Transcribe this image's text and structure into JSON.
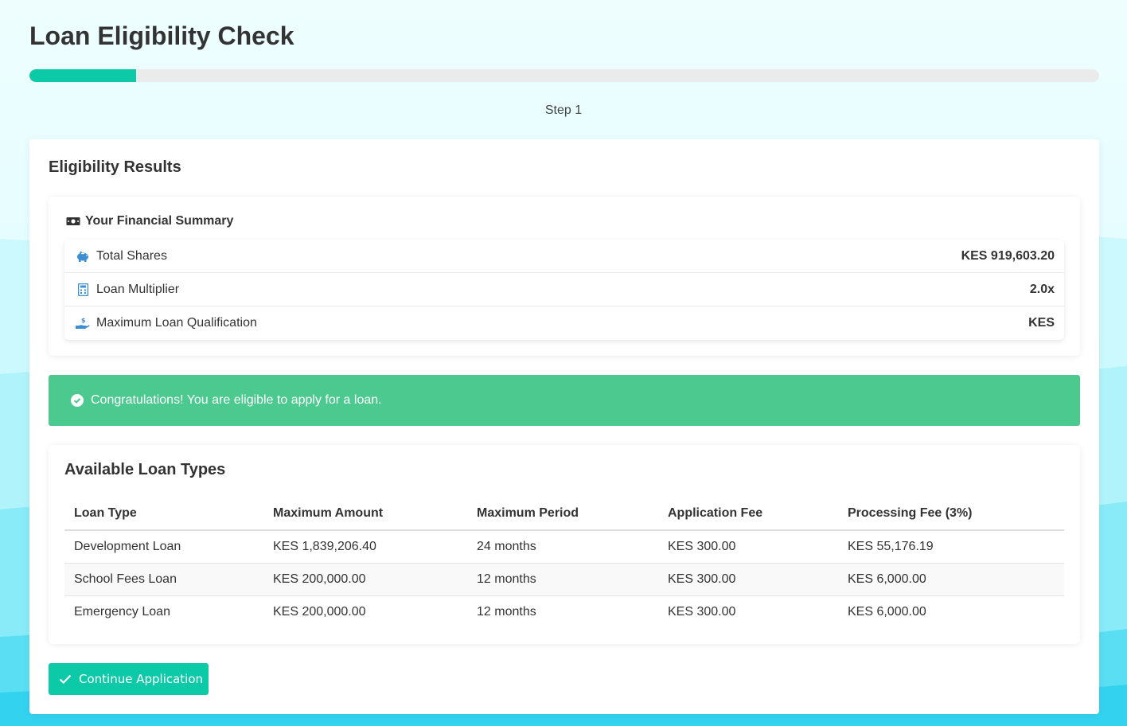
{
  "header": {
    "title": "Loan Eligibility Check",
    "step_label": "Step 1",
    "progress_percent": 10
  },
  "results": {
    "title": "Eligibility Results",
    "summary": {
      "title": "Your Financial Summary",
      "icon": "money-bill-icon",
      "rows": [
        {
          "icon": "piggy-bank-icon",
          "label": "Total Shares",
          "value": "KES 919,603.20"
        },
        {
          "icon": "calculator-icon",
          "label": "Loan Multiplier",
          "value": "2.0x"
        },
        {
          "icon": "hand-holding-usd-icon",
          "label": "Maximum Loan Qualification",
          "value": "KES"
        }
      ]
    },
    "alert": {
      "icon": "check-circle-icon",
      "message": "Congratulations! You are eligible to apply for a loan."
    },
    "loan_types": {
      "title": "Available Loan Types",
      "columns": [
        "Loan Type",
        "Maximum Amount",
        "Maximum Period",
        "Application Fee",
        "Processing Fee (3%)"
      ],
      "rows": [
        [
          "Development Loan",
          "KES 1,839,206.40",
          "24 months",
          "KES 300.00",
          "KES 55,176.19"
        ],
        [
          "School Fees Loan",
          "KES 200,000.00",
          "12 months",
          "KES 300.00",
          "KES 6,000.00"
        ],
        [
          "Emergency Loan",
          "KES 200,000.00",
          "12 months",
          "KES 300.00",
          "KES 6,000.00"
        ]
      ]
    },
    "continue_button": {
      "icon": "check-icon",
      "label": "Continue Application"
    }
  },
  "colors": {
    "accent": "#0cc9a8",
    "success": "#4bc98f",
    "icon_blue": "#3d8fd4"
  }
}
